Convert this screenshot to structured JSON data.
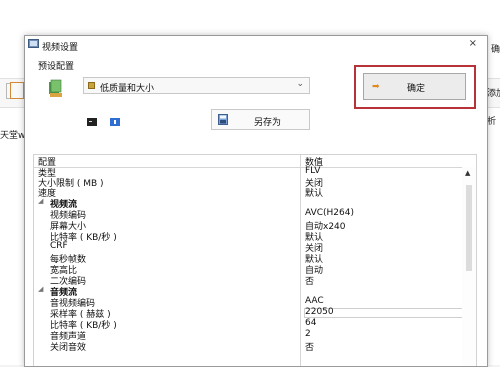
{
  "background": {
    "right_top_text": "确",
    "right_mid_text": "添加",
    "right_low_text": "析",
    "left_text": "天堂w"
  },
  "dialog": {
    "title": "视频设置",
    "close_symbol": "×",
    "preset_section_label": "预设配置",
    "preset_value": "低质量和大小",
    "confirm_label": "确定",
    "save_as_label": "另存为"
  },
  "table": {
    "header": {
      "key": "配置",
      "value": "数值"
    },
    "rows": [
      {
        "key": "类型",
        "value": "FLV"
      },
      {
        "key": "大小限制 ( MB )",
        "value": "关闭"
      },
      {
        "key": "速度",
        "value": "默认"
      },
      {
        "key": "视频流",
        "value": "",
        "category": true
      },
      {
        "key": "视频编码",
        "value": "AVC(H264)"
      },
      {
        "key": "屏幕大小",
        "value": "自动x240"
      },
      {
        "key": "比特率 ( KB/秒 )",
        "value": "默认"
      },
      {
        "key": "CRF",
        "value": "关闭"
      },
      {
        "key": "每秒帧数",
        "value": "默认"
      },
      {
        "key": "宽高比",
        "value": "自动"
      },
      {
        "key": "二次编码",
        "value": "否"
      },
      {
        "key": "音频流",
        "value": "",
        "category": true
      },
      {
        "key": "音视频编码",
        "value": "AAC"
      },
      {
        "key": "采样率 ( 赫兹 )",
        "value": "22050"
      },
      {
        "key": "比特率 ( KB/秒 )",
        "value": "64"
      },
      {
        "key": "音频声道",
        "value": "2"
      },
      {
        "key": "关闭音效",
        "value": "否"
      }
    ]
  },
  "colors": {
    "accent_frame": "#b8323a",
    "arrow": "#e08a1e"
  },
  "icons": [
    "video-settings-icon",
    "format-factory-icon",
    "chevron-down-icon",
    "arrow-right-icon",
    "save-icon",
    "help-icon",
    "terminal-icon",
    "scroll-up-icon",
    "expander-icon"
  ]
}
